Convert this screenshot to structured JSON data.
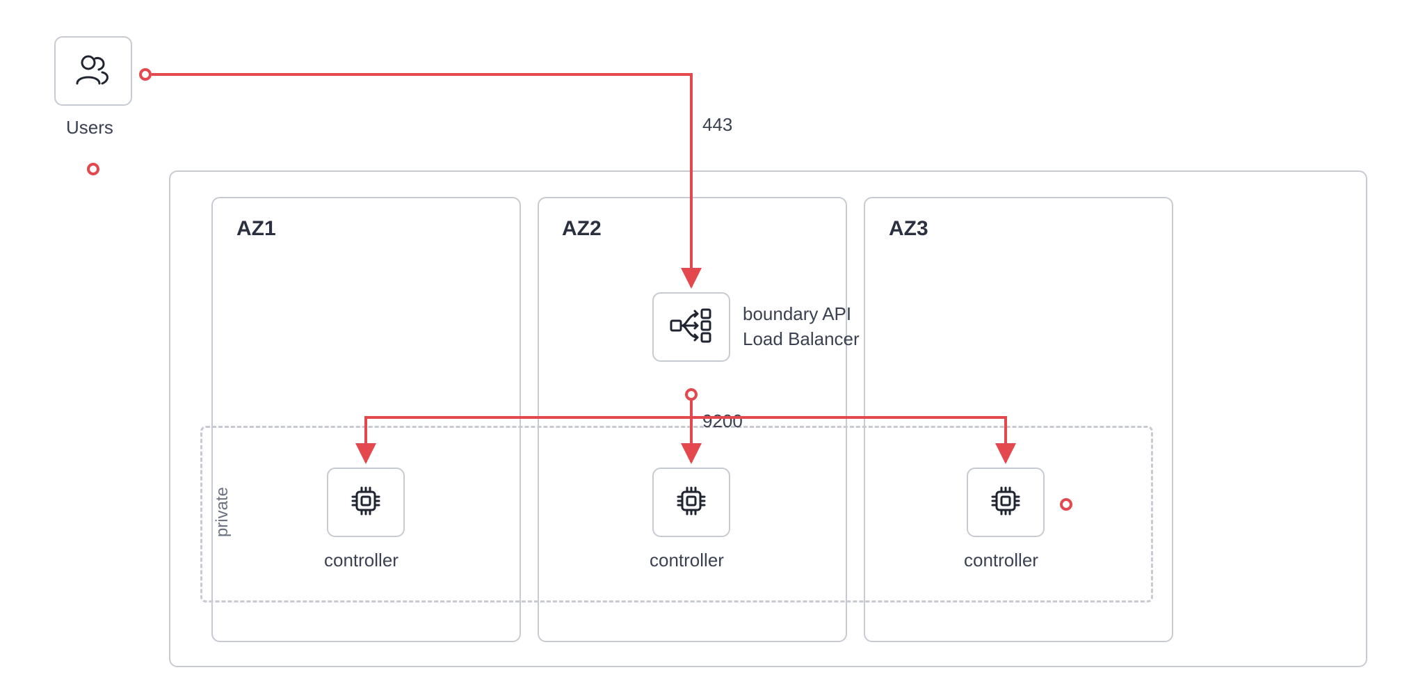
{
  "users": {
    "label": "Users"
  },
  "ports": {
    "api": "443",
    "controller": "9200"
  },
  "region": {
    "zones": [
      {
        "title": "AZ1"
      },
      {
        "title": "AZ2"
      },
      {
        "title": "AZ3"
      }
    ],
    "lb": {
      "line1": "boundary API",
      "line2": "Load Balancer"
    },
    "private_label": "private",
    "controllers": [
      {
        "label": "controller"
      },
      {
        "label": "controller"
      },
      {
        "label": "controller"
      }
    ]
  },
  "colors": {
    "accent": "#e4484f",
    "border": "#c7cbd1",
    "text": "#3b4150"
  }
}
